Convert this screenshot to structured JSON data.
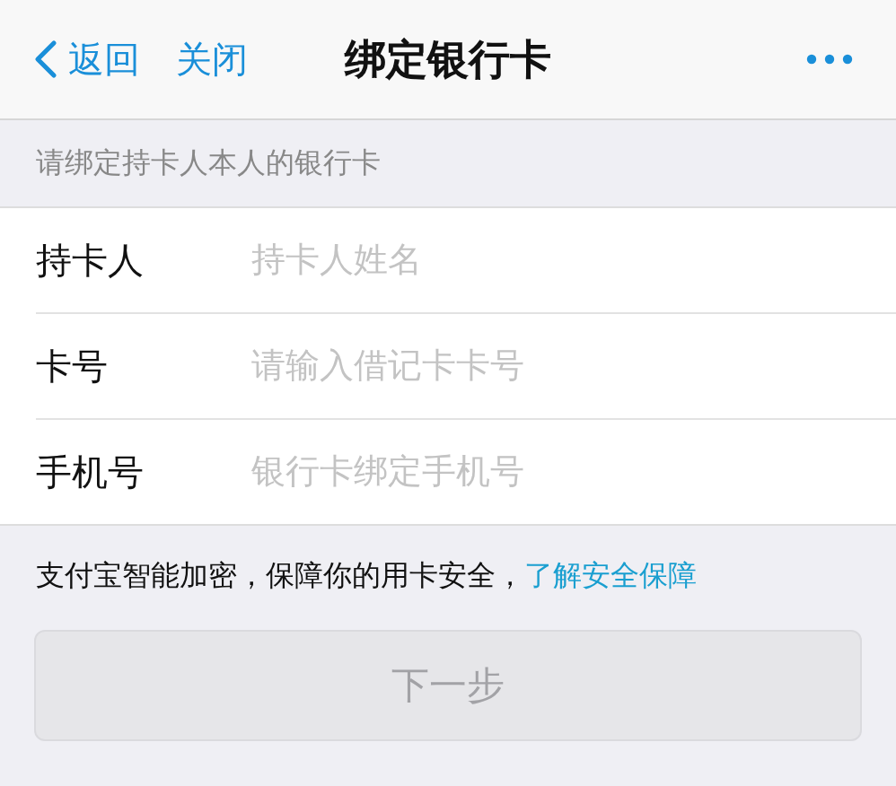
{
  "nav": {
    "back": "返回",
    "close": "关闭",
    "title": "绑定银行卡"
  },
  "section_header": "请绑定持卡人本人的银行卡",
  "fields": [
    {
      "label": "持卡人",
      "placeholder": "持卡人姓名"
    },
    {
      "label": "卡号",
      "placeholder": "请输入借记卡卡号"
    },
    {
      "label": "手机号",
      "placeholder": "银行卡绑定手机号"
    }
  ],
  "notice": {
    "text": "支付宝智能加密，保障你的用卡安全，",
    "link": "了解安全保障"
  },
  "next_button": {
    "label": "下一步",
    "disabled": true
  }
}
